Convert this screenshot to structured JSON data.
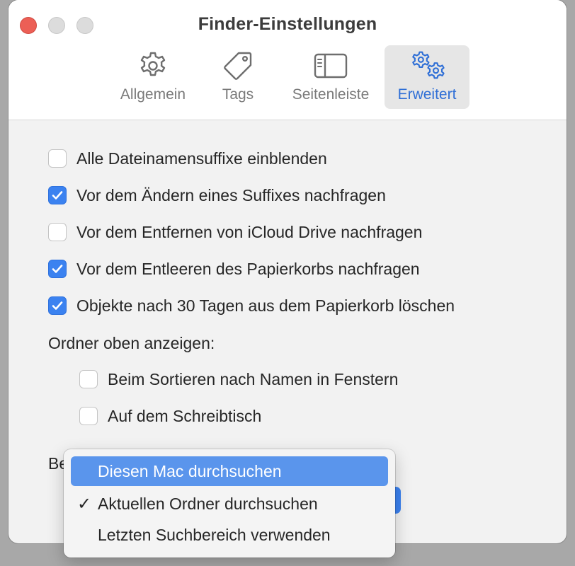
{
  "window": {
    "title": "Finder-Einstellungen"
  },
  "tabs": [
    {
      "label": "Allgemein",
      "icon": "gear-icon",
      "active": false
    },
    {
      "label": "Tags",
      "icon": "tag-icon",
      "active": false
    },
    {
      "label": "Seitenleiste",
      "icon": "sidebar-icon",
      "active": false
    },
    {
      "label": "Erweitert",
      "icon": "gears-icon",
      "active": true
    }
  ],
  "options": [
    {
      "label": "Alle Dateinamensuffixe einblenden",
      "checked": false
    },
    {
      "label": "Vor dem Ändern eines Suffixes nachfragen",
      "checked": true
    },
    {
      "label": "Vor dem Entfernen von iCloud Drive nachfragen",
      "checked": false
    },
    {
      "label": "Vor dem Entleeren des Papierkorbs nachfragen",
      "checked": true
    },
    {
      "label": "Objekte nach 30 Tagen aus dem Papierkorb löschen",
      "checked": true
    }
  ],
  "folders_on_top": {
    "label": "Ordner oben anzeigen:",
    "options": [
      {
        "label": "Beim Sortieren nach Namen in Fenstern",
        "checked": false
      },
      {
        "label": "Auf dem Schreibtisch",
        "checked": false
      }
    ]
  },
  "search": {
    "label_visible_fragment": "Be"
  },
  "search_menu": {
    "items": [
      {
        "label": "Diesen Mac durchsuchen",
        "checked": false,
        "highlighted": true
      },
      {
        "label": "Aktuellen Ordner durchsuchen",
        "checked": true,
        "highlighted": false
      },
      {
        "label": "Letzten Suchbereich verwenden",
        "checked": false,
        "highlighted": false
      }
    ],
    "check_glyph": "✓"
  },
  "colors": {
    "accent": "#3b82f0",
    "highlight": "#5a95ec",
    "close": "#ec5f56"
  }
}
